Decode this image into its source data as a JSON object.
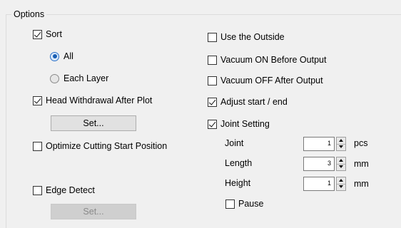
{
  "group_title": "Options",
  "left": {
    "sort": {
      "label": "Sort",
      "checked": true
    },
    "radio_all": {
      "label": "All",
      "selected": true
    },
    "radio_each_layer": {
      "label": "Each Layer",
      "selected": false
    },
    "head_withdrawal": {
      "label": "Head Withdrawal After Plot",
      "checked": true
    },
    "set_button_1": "Set...",
    "optimize_start": {
      "label": "Optimize Cutting Start Position",
      "checked": false
    },
    "edge_detect": {
      "label": "Edge Detect",
      "checked": false
    },
    "set_button_2": "Set..."
  },
  "right": {
    "use_outside": {
      "label": "Use the Outside",
      "checked": false
    },
    "vacuum_on": {
      "label": "Vacuum ON Before Output",
      "checked": false
    },
    "vacuum_off": {
      "label": "Vacuum OFF After Output",
      "checked": false
    },
    "adjust_start_end": {
      "label": "Adjust start / end",
      "checked": true
    },
    "joint_setting": {
      "label": "Joint Setting",
      "checked": true
    },
    "joint": {
      "label": "Joint",
      "value": "1",
      "unit": "pcs"
    },
    "length": {
      "label": "Length",
      "value": "3",
      "unit": "mm"
    },
    "height": {
      "label": "Height",
      "value": "1",
      "unit": "mm"
    },
    "pause": {
      "label": "Pause",
      "checked": false
    }
  }
}
